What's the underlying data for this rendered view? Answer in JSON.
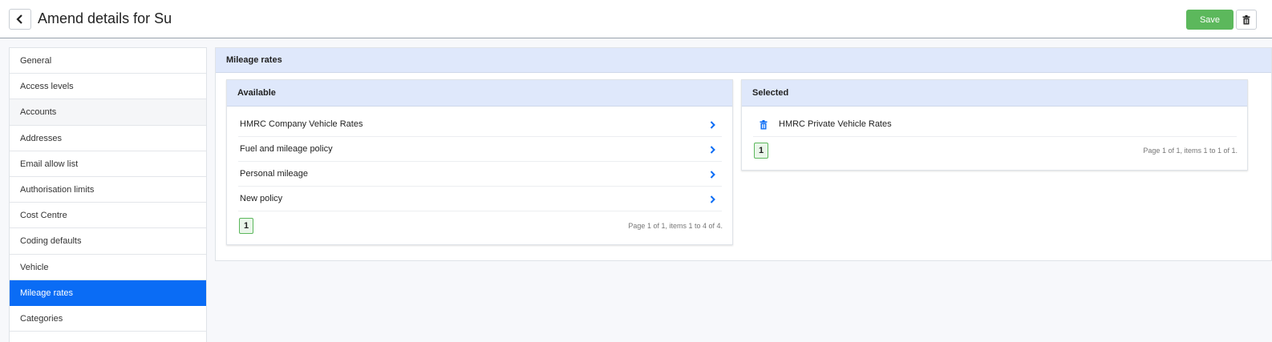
{
  "header": {
    "title": "Amend details for Su",
    "back_icon": "chevron-left-icon",
    "save_label": "Save",
    "delete_icon": "trash-icon"
  },
  "sidebar": {
    "items": [
      {
        "label": "General"
      },
      {
        "label": "Access levels"
      },
      {
        "label": "Accounts"
      },
      {
        "label": "Addresses"
      },
      {
        "label": "Email allow list"
      },
      {
        "label": "Authorisation limits"
      },
      {
        "label": "Cost Centre"
      },
      {
        "label": "Coding defaults"
      },
      {
        "label": "Vehicle"
      },
      {
        "label": "Mileage rates"
      },
      {
        "label": "Categories"
      }
    ],
    "active_index": 9
  },
  "main": {
    "title": "Mileage rates",
    "available": {
      "title": "Available",
      "items": [
        {
          "label": "HMRC Company Vehicle Rates"
        },
        {
          "label": "Fuel and mileage policy"
        },
        {
          "label": "Personal mileage"
        },
        {
          "label": "New policy"
        }
      ],
      "page": "1",
      "page_info": "Page 1 of 1, items 1 to 4 of 4."
    },
    "selected": {
      "title": "Selected",
      "items": [
        {
          "label": "HMRC Private Vehicle Rates"
        }
      ],
      "page": "1",
      "page_info": "Page 1 of 1, items 1 to 1 of 1."
    }
  },
  "colors": {
    "accent": "#0a6cf5",
    "save": "#5cb85c",
    "panel_header": "#dfe8fb"
  }
}
